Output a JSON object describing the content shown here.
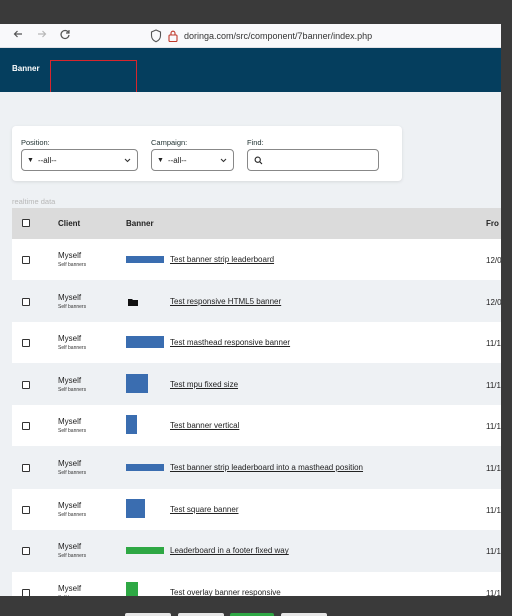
{
  "browser": {
    "url": "doringa.com/src/component/7banner/index.php",
    "icons": [
      "back-arrow-icon",
      "forward-arrow-icon",
      "reload-icon",
      "shield-icon",
      "lock-icon"
    ]
  },
  "app": {
    "title": "Banner"
  },
  "filters": {
    "position_label": "Position:",
    "position_value": "--all--",
    "campaign_label": "Campaign:",
    "campaign_value": "--all--",
    "find_label": "Find:",
    "find_value": ""
  },
  "realtime_label": "realtime data",
  "table": {
    "headers": {
      "client": "Client",
      "banner": "Banner",
      "from": "Fro"
    },
    "rows": [
      {
        "client": "Myself",
        "sub": "Self banners",
        "banner": "Test banner strip leaderboard",
        "from": "12/0",
        "thumb": "leaderboard"
      },
      {
        "client": "Myself",
        "sub": "Self banners",
        "banner": "Test responsive HTML5 banner",
        "from": "12/0",
        "thumb": "folder"
      },
      {
        "client": "Myself",
        "sub": "Self banners",
        "banner": "Test masthead responsive banner",
        "from": "11/1",
        "thumb": "masthead"
      },
      {
        "client": "Myself",
        "sub": "Self banners",
        "banner": "Test mpu fixed size",
        "from": "11/1",
        "thumb": "mpu"
      },
      {
        "client": "Myself",
        "sub": "Self banners",
        "banner": "Test banner vertical",
        "from": "11/1",
        "thumb": "vertical"
      },
      {
        "client": "Myself",
        "sub": "Self banners",
        "banner": "Test banner strip leaderboard into a masthead position",
        "from": "11/1",
        "thumb": "leaderboard"
      },
      {
        "client": "Myself",
        "sub": "Self banners",
        "banner": "Test square banner",
        "from": "11/1",
        "thumb": "square"
      },
      {
        "client": "Myself",
        "sub": "Self banners",
        "banner": "Leaderboard in a footer fixed way",
        "from": "11/1",
        "thumb": "green-leaderboard"
      },
      {
        "client": "Myself",
        "sub": "Self banners",
        "banner": "Test overlay banner responsive",
        "from": "11/1",
        "thumb": "green-vertical"
      }
    ]
  },
  "colors": {
    "header_bg": "#053e5e",
    "highlight": "#d8262d",
    "thumb_blue": "#3a6db0",
    "thumb_green": "#2ea844",
    "row_alt": "#eef1f4",
    "thead_bg": "#dbdbdb"
  }
}
